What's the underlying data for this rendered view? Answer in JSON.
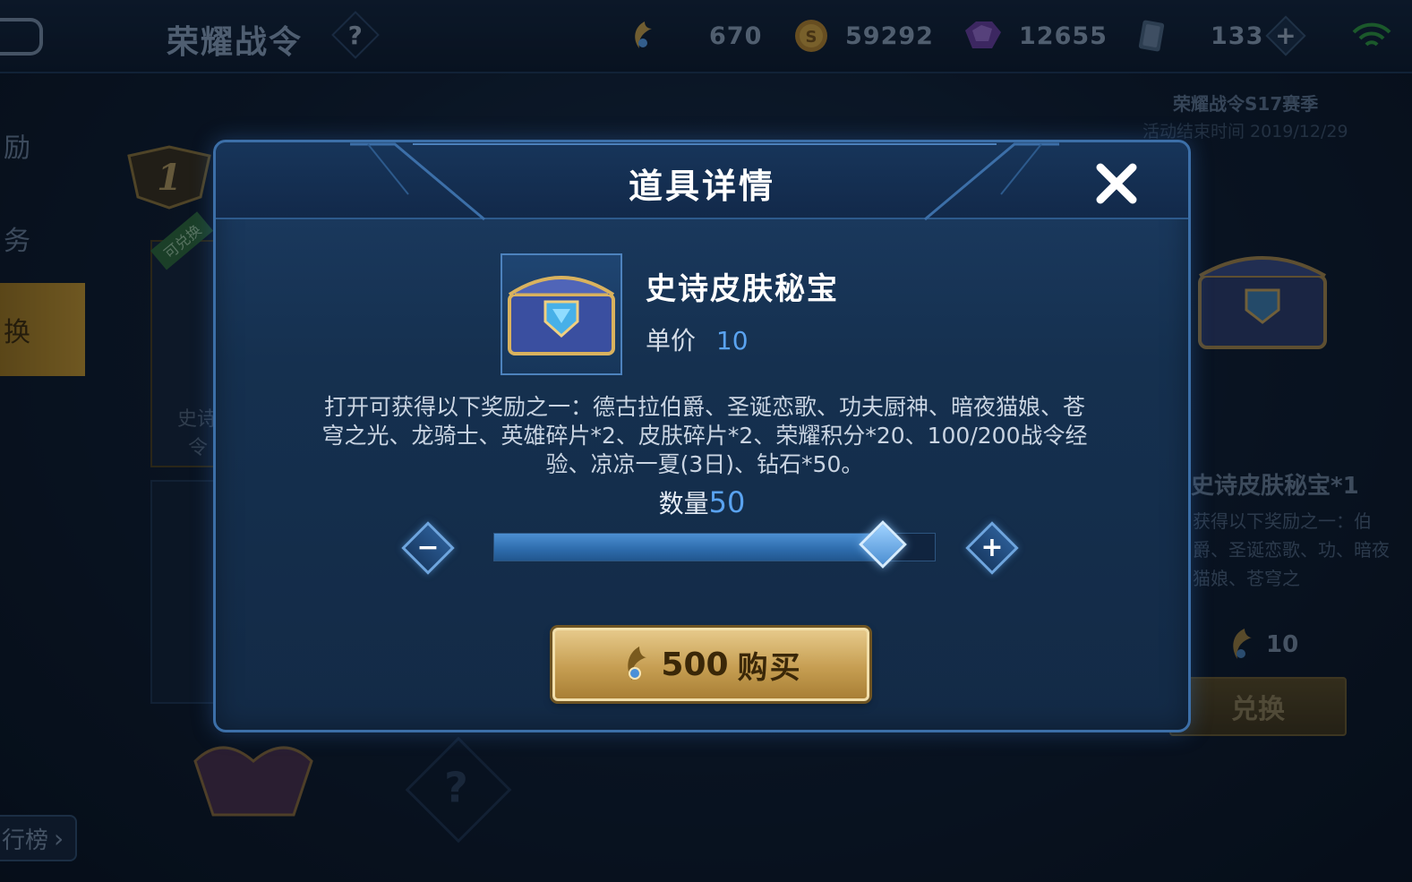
{
  "header": {
    "title": "荣耀战令",
    "help_symbol": "?",
    "currencies": [
      {
        "icon": "battlepass-token-icon",
        "value": "670"
      },
      {
        "icon": "gold-coin-icon",
        "value": "59292"
      },
      {
        "icon": "gem-icon",
        "value": "12655"
      },
      {
        "icon": "ticket-card-icon",
        "value": "133"
      }
    ],
    "add_symbol": "+"
  },
  "left_nav": {
    "items": [
      {
        "label": "励",
        "active": false
      },
      {
        "label": "务",
        "active": false
      },
      {
        "label": "换",
        "active": true
      }
    ],
    "rank_label": "行榜",
    "card_tag": "可兑换",
    "card_text_1": "史诗",
    "card_text_2": "令",
    "rank_number": "1"
  },
  "right_panel": {
    "season_title": "荣耀战令S17赛季",
    "season_end": "活动结束时间 2019/12/29",
    "item_name": "史诗皮肤秘宝*1",
    "item_desc": "获得以下奖励之一：伯爵、圣诞恋歌、功、暗夜猫娘、苍穹之",
    "price": "10",
    "exchange_label": "兑换"
  },
  "background": {
    "mystery_symbol": "?"
  },
  "modal": {
    "title": "道具详情",
    "item_name": "史诗皮肤秘宝",
    "price_label": "单价",
    "price_value": "10",
    "description": "打开可获得以下奖励之一：德古拉伯爵、圣诞恋歌、功夫厨神、暗夜猫娘、苍穹之光、龙骑士、英雄碎片*2、皮肤碎片*2、荣耀积分*20、100/200战令经验、凉凉一夏(3日)、钻石*50。",
    "quantity_label": "数量",
    "quantity_value": "50",
    "quantity_fraction": 0.88,
    "minus_symbol": "−",
    "plus_symbol": "+",
    "buy_amount": "500",
    "buy_label": "购买"
  },
  "colors": {
    "accent_blue": "#5aa3f0",
    "gold": "#c69e52",
    "modal_border": "#3c6fa8"
  }
}
